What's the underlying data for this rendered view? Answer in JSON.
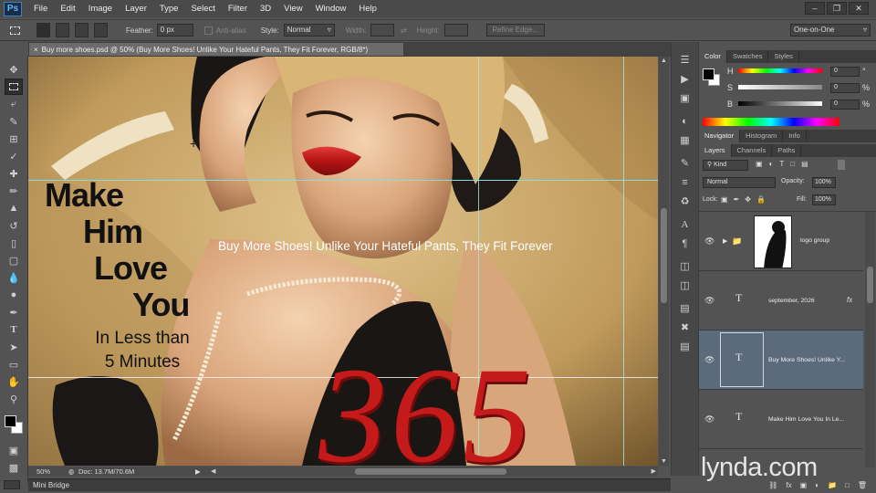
{
  "app": {
    "logo": "Ps",
    "menus": [
      "File",
      "Edit",
      "Image",
      "Layer",
      "Type",
      "Select",
      "Filter",
      "3D",
      "View",
      "Window",
      "Help"
    ],
    "window_controls": [
      "minimize-icon",
      "restore-icon",
      "close-icon"
    ]
  },
  "options_bar": {
    "feather_label": "Feather:",
    "feather_value": "0 px",
    "antialias_label": "Anti-alias",
    "style_label": "Style:",
    "style_value": "Normal",
    "width_label": "Width:",
    "height_label": "Height:",
    "refine_edge": "Refine Edge...",
    "workspace": "One-on-One"
  },
  "document": {
    "tab_title": "Buy more shoes.psd @ 50% (Buy More Shoes! Unlike Your Hateful Pants, They Fit Forever, RGB/8*)",
    "zoom": "50%",
    "doc_size": "Doc: 13.7M/70.6M",
    "mini_bridge": "Mini Bridge"
  },
  "artwork": {
    "headline_lines": [
      "Make",
      "Him",
      "Love",
      "You"
    ],
    "subline_lines": [
      "In Less than",
      "5 Minutes"
    ],
    "tagline": "Buy More Shoes! Unlike Your Hateful Pants, They Fit Forever",
    "big_number": "365"
  },
  "color_panel": {
    "tabs": [
      "Color",
      "Swatches",
      "Styles"
    ],
    "channels": [
      {
        "label": "H",
        "value": "0",
        "unit": "°"
      },
      {
        "label": "S",
        "value": "0",
        "unit": "%"
      },
      {
        "label": "B",
        "value": "0",
        "unit": "%"
      }
    ]
  },
  "navigator_panel": {
    "tabs": [
      "Navigator",
      "Histogram",
      "Info"
    ]
  },
  "layers_panel": {
    "tabs": [
      "Layers",
      "Channels",
      "Paths"
    ],
    "kind_label": "Kind",
    "blend_mode": "Normal",
    "opacity_label": "Opacity:",
    "opacity_value": "100%",
    "lock_label": "Lock:",
    "fill_label": "Fill:",
    "fill_value": "100%",
    "layers": [
      {
        "name": "logo group",
        "type": "group"
      },
      {
        "name": "september, 2026",
        "type": "text",
        "fx": "fx"
      },
      {
        "name": "Buy More Shoes! Unlike Y...",
        "type": "text",
        "selected": true
      },
      {
        "name": "Make Him Love You In Le...",
        "type": "text"
      }
    ]
  },
  "watermark": {
    "text": "lynda.com"
  },
  "colors": {
    "ui_bg": "#535353",
    "selection": "#5c6b7c",
    "lips": "#b0121c",
    "number_red": "#c41a1a",
    "guide": "#7fe0e0"
  }
}
